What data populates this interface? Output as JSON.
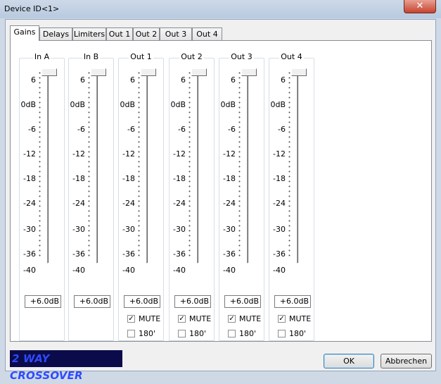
{
  "window": {
    "title": "Device ID<1>",
    "close_symbol": "✕"
  },
  "tabs": [
    "Gains",
    "Delays",
    "Limiters",
    "Out 1",
    "Out 2",
    "Out 3",
    "Out 4"
  ],
  "active_tab": "Gains",
  "scale_ticks": [
    "6",
    "0dB",
    "-6",
    "-12",
    "-18",
    "-24",
    "-30",
    "-36",
    "-40"
  ],
  "channels": [
    {
      "name": "In A",
      "value": "+6.0dB",
      "level_db": 6,
      "has_mute": false
    },
    {
      "name": "In B",
      "value": "+6.0dB",
      "level_db": 6,
      "has_mute": false
    },
    {
      "name": "Out 1",
      "value": "+6.0dB",
      "level_db": 6,
      "has_mute": true,
      "mute_label": "MUTE",
      "mute_checked": true,
      "phase_label": "180'",
      "phase_checked": false
    },
    {
      "name": "Out 2",
      "value": "+6.0dB",
      "level_db": 6,
      "has_mute": true,
      "mute_label": "MUTE",
      "mute_checked": true,
      "phase_label": "180'",
      "phase_checked": false
    },
    {
      "name": "Out 3",
      "value": "+6.0dB",
      "level_db": 6,
      "has_mute": true,
      "mute_label": "MUTE",
      "mute_checked": true,
      "phase_label": "180'",
      "phase_checked": false
    },
    {
      "name": "Out 4",
      "value": "+6.0dB",
      "level_db": 6,
      "has_mute": true,
      "mute_label": "MUTE",
      "mute_checked": true,
      "phase_label": "180'",
      "phase_checked": false
    }
  ],
  "brand": "2 WAY CROSSOVER",
  "buttons": {
    "ok": "OK",
    "cancel": "Abbrechen"
  }
}
